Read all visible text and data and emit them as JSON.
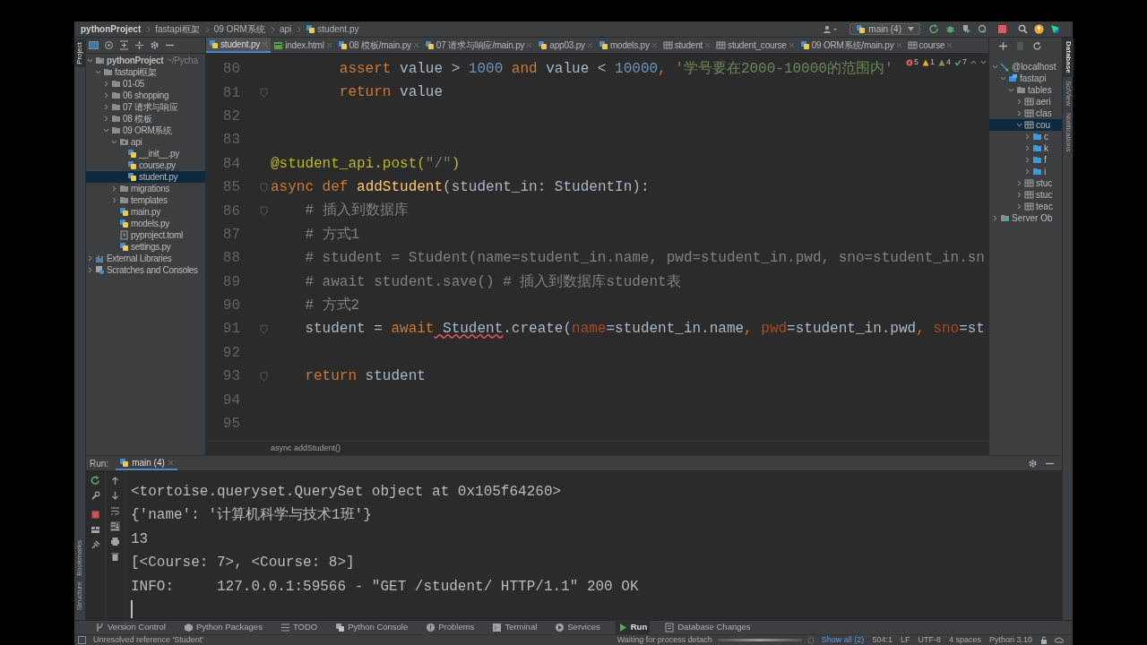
{
  "breadcrumb": [
    "pythonProject",
    "fastapi框架",
    "09 ORM系统",
    "api",
    "student.py"
  ],
  "run_config": {
    "label": "main (4)"
  },
  "tool_windows_left": [
    {
      "label": "Project",
      "selected": true
    },
    {
      "label": "Bookmarks",
      "selected": false
    },
    {
      "label": "Structure",
      "selected": false
    }
  ],
  "tool_windows_right": [
    {
      "label": "Database",
      "selected": true
    },
    {
      "label": "SciView",
      "selected": false
    },
    {
      "label": "Notifications",
      "selected": false
    }
  ],
  "project_tree": [
    {
      "label": "pythonProject",
      "note": "~/Pycha",
      "kind": "folder",
      "expanded": true,
      "selected": false,
      "children": [
        {
          "label": "fastapi框架",
          "kind": "folder",
          "expanded": true,
          "selected": false,
          "children": [
            {
              "label": "01-05",
              "kind": "folder",
              "expanded": false,
              "selected": false
            },
            {
              "label": "06 shopping",
              "kind": "folder",
              "expanded": false,
              "selected": false
            },
            {
              "label": "07 请求与响应",
              "kind": "folder",
              "expanded": false,
              "selected": false
            },
            {
              "label": "08 模板",
              "kind": "folder",
              "expanded": false,
              "selected": false
            },
            {
              "label": "09 ORM系统",
              "kind": "folder",
              "expanded": true,
              "selected": false,
              "children": [
                {
                  "label": "api",
                  "kind": "package",
                  "expanded": true,
                  "selected": false,
                  "children": [
                    {
                      "label": "__init__.py",
                      "kind": "python",
                      "selected": false
                    },
                    {
                      "label": "course.py",
                      "kind": "python",
                      "selected": false
                    },
                    {
                      "label": "student.py",
                      "kind": "python",
                      "selected": true
                    }
                  ]
                },
                {
                  "label": "migrations",
                  "kind": "folder",
                  "expanded": false,
                  "selected": false
                },
                {
                  "label": "templates",
                  "kind": "folder",
                  "expanded": false,
                  "selected": false
                },
                {
                  "label": "main.py",
                  "kind": "python",
                  "selected": false
                },
                {
                  "label": "models.py",
                  "kind": "python",
                  "selected": false
                },
                {
                  "label": "pyproject.toml",
                  "kind": "text",
                  "selected": false
                },
                {
                  "label": "settings.py",
                  "kind": "python",
                  "selected": false
                }
              ]
            }
          ]
        }
      ]
    },
    {
      "label": "External Libraries",
      "kind": "library",
      "expanded": false,
      "selected": false
    },
    {
      "label": "Scratches and Consoles",
      "kind": "scratch",
      "expanded": false,
      "selected": false
    }
  ],
  "editor_tabs": [
    {
      "label": "student.py",
      "kind": "python",
      "selected": true
    },
    {
      "label": "index.html",
      "kind": "html",
      "selected": false
    },
    {
      "label": "08 模板/main.py",
      "kind": "python",
      "selected": false
    },
    {
      "label": "07 请求与响应/main.py",
      "kind": "python",
      "selected": false
    },
    {
      "label": "app03.py",
      "kind": "python",
      "selected": false
    },
    {
      "label": "models.py",
      "kind": "python",
      "selected": false
    },
    {
      "label": "student",
      "kind": "table",
      "selected": false
    },
    {
      "label": "student_course",
      "kind": "table",
      "selected": false
    },
    {
      "label": "09 ORM系统/main.py",
      "kind": "python",
      "selected": false
    },
    {
      "label": "course",
      "kind": "table",
      "selected": false
    }
  ],
  "inspections": [
    {
      "kind": "error",
      "count": "5"
    },
    {
      "kind": "warning",
      "count": "1"
    },
    {
      "kind": "weak",
      "count": "4"
    },
    {
      "kind": "typo",
      "count": "7"
    }
  ],
  "code_lines": [
    {
      "number": "80",
      "fold": false,
      "tokens": [
        {
          "kind": "kw",
          "text": "        assert"
        },
        {
          "kind": "plain",
          "text": " value > "
        },
        {
          "kind": "num",
          "text": "1000"
        },
        {
          "kind": "kw",
          "text": " and"
        },
        {
          "kind": "plain",
          "text": " value < "
        },
        {
          "kind": "num",
          "text": "10000"
        },
        {
          "kind": "kw",
          "text": ", "
        },
        {
          "kind": "str",
          "text": "'学号要在2000-10000的范围内'"
        }
      ]
    },
    {
      "number": "81",
      "fold": true,
      "tokens": [
        {
          "kind": "kw",
          "text": "        return"
        },
        {
          "kind": "plain",
          "text": " value"
        }
      ]
    },
    {
      "number": "82",
      "fold": false
    },
    {
      "number": "83",
      "fold": false
    },
    {
      "number": "84",
      "fold": false,
      "tokens": [
        {
          "kind": "dec",
          "text": "@student_api.post("
        },
        {
          "kind": "str",
          "text": "\"/\""
        },
        {
          "kind": "dec",
          "text": ")"
        }
      ]
    },
    {
      "number": "85",
      "fold": true,
      "tokens": [
        {
          "kind": "kw",
          "text": "async"
        },
        {
          "kind": "kw",
          "text": " def"
        },
        {
          "kind": "fn",
          "text": " addStudent"
        },
        {
          "kind": "plain",
          "text": "(student_in: StudentIn):"
        }
      ]
    },
    {
      "number": "86",
      "fold": true,
      "tokens": [
        {
          "kind": "cmt",
          "text": "    # 插入到数据库"
        }
      ]
    },
    {
      "number": "87",
      "fold": false,
      "tokens": [
        {
          "kind": "cmt",
          "text": "    # 方式1"
        }
      ]
    },
    {
      "number": "88",
      "fold": false,
      "tokens": [
        {
          "kind": "cmt",
          "text": "    # student = Student(name=student_in.name, pwd=student_in.pwd, sno=student_in.sn"
        }
      ]
    },
    {
      "number": "89",
      "fold": false,
      "tokens": [
        {
          "kind": "cmt",
          "text": "    # await student.save() # 插入到数据库student表"
        }
      ]
    },
    {
      "number": "90",
      "fold": false,
      "tokens": [
        {
          "kind": "cmt",
          "text": "    # 方式2"
        }
      ]
    },
    {
      "number": "91",
      "fold": true,
      "tokens": [
        {
          "kind": "plain",
          "text": "    student = "
        },
        {
          "kind": "kw",
          "text": "await"
        },
        {
          "kind": "err",
          "text": " Student"
        },
        {
          "kind": "plain",
          "text": ".create("
        },
        {
          "kind": "param",
          "text": "name"
        },
        {
          "kind": "plain",
          "text": "=student_in.name"
        },
        {
          "kind": "kw",
          "text": ", "
        },
        {
          "kind": "param",
          "text": "pwd"
        },
        {
          "kind": "plain",
          "text": "=student_in.pwd"
        },
        {
          "kind": "kw",
          "text": ", "
        },
        {
          "kind": "param",
          "text": "sno"
        },
        {
          "kind": "plain",
          "text": "=st"
        }
      ]
    },
    {
      "number": "92",
      "fold": false
    },
    {
      "number": "93",
      "fold": true,
      "tokens": [
        {
          "kind": "kw",
          "text": "    return"
        },
        {
          "kind": "plain",
          "text": " student"
        }
      ]
    },
    {
      "number": "94",
      "fold": false
    },
    {
      "number": "95",
      "fold": false
    }
  ],
  "editor_breadcrumb": "async addStudent()",
  "database_tree": [
    {
      "label": "@localhost",
      "kind": "server",
      "expanded": true,
      "selected": false,
      "children": [
        {
          "label": "fastapi",
          "kind": "schema",
          "expanded": true,
          "selected": false,
          "children": [
            {
              "label": "tables",
              "kind": "folder",
              "expanded": true,
              "selected": false,
              "children": [
                {
                  "label": "aeri",
                  "kind": "table",
                  "expanded": false,
                  "selected": false
                },
                {
                  "label": "clas",
                  "kind": "table",
                  "expanded": false,
                  "selected": false
                },
                {
                  "label": "cou",
                  "kind": "table",
                  "expanded": true,
                  "selected": true,
                  "children": [
                    {
                      "label": "c",
                      "kind": "dbfolder",
                      "expanded": false,
                      "selected": false
                    },
                    {
                      "label": "k",
                      "kind": "dbfolder",
                      "expanded": false,
                      "selected": false
                    },
                    {
                      "label": "f",
                      "kind": "dbfolder",
                      "expanded": false,
                      "selected": false
                    },
                    {
                      "label": "i",
                      "kind": "dbfolder",
                      "expanded": false,
                      "selected": false
                    }
                  ]
                },
                {
                  "label": "stuc",
                  "kind": "table",
                  "expanded": false,
                  "selected": false
                },
                {
                  "label": "stuc",
                  "kind": "table",
                  "expanded": false,
                  "selected": false
                },
                {
                  "label": "teac",
                  "kind": "table",
                  "expanded": false,
                  "selected": false
                }
              ]
            }
          ]
        }
      ]
    },
    {
      "label": "Server Ob",
      "kind": "serverobj",
      "expanded": false,
      "selected": false
    }
  ],
  "run_panel": {
    "label": "Run:",
    "tabs": [
      {
        "label": "main (4)",
        "selected": true
      }
    ],
    "console": [
      "<tortoise.queryset.QuerySet object at 0x105f64260>",
      "{'name': '计算机科学与技术1班'}",
      "13",
      "[<Course: 7>, <Course: 8>]",
      "INFO:     127.0.0.1:59566 - \"GET /student/ HTTP/1.1\" 200 OK"
    ]
  },
  "bottom_tools": [
    {
      "label": "Version Control",
      "selected": false
    },
    {
      "label": "Python Packages",
      "selected": false
    },
    {
      "label": "TODO",
      "selected": false
    },
    {
      "label": "Python Console",
      "selected": false
    },
    {
      "label": "Problems",
      "selected": false
    },
    {
      "label": "Terminal",
      "selected": false
    },
    {
      "label": "Services",
      "selected": false
    },
    {
      "label": "Run",
      "selected": true
    },
    {
      "label": "Database Changes",
      "selected": false
    }
  ],
  "status_bar": {
    "message": "Unresolved reference 'Student'",
    "process": "Waiting for process detach",
    "progress": {
      "level": 1
    },
    "link": "Show all (2)",
    "fields": [
      "504:1",
      "LF",
      "UTF-8",
      "4 spaces",
      "Python 3.10"
    ]
  }
}
